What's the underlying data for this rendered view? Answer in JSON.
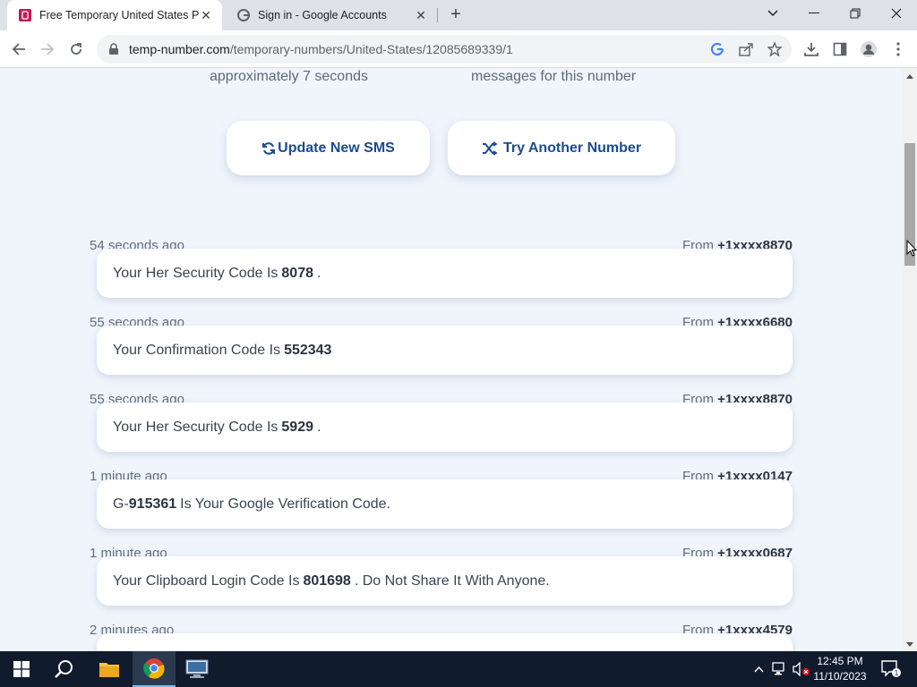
{
  "browser": {
    "tabs": [
      {
        "title": "Free Temporary United States Ph",
        "active": true
      },
      {
        "title": "Sign in - Google Accounts",
        "active": false
      }
    ],
    "url": {
      "host": "temp-number.com",
      "path": "/temporary-numbers/United-States/12085689339/1"
    }
  },
  "page": {
    "info_left": "approximately 7 seconds",
    "info_right": "messages for this number",
    "buttons": {
      "update": "Update New SMS",
      "another": "Try Another Number"
    },
    "from_prefix": "From",
    "messages": [
      {
        "time": "54 seconds ago",
        "from": "+1xxxx8870",
        "pre": "Your Her Security Code Is",
        "code": "8078",
        "post": "."
      },
      {
        "time": "55 seconds ago",
        "from": "+1xxxx6680",
        "pre": "Your Confirmation Code Is",
        "code": "552343",
        "post": ""
      },
      {
        "time": "55 seconds ago",
        "from": "+1xxxx8870",
        "pre": "Your Her Security Code Is",
        "code": "5929",
        "post": "."
      },
      {
        "time": "1 minute ago",
        "from": "+1xxxx0147",
        "pre": "G-",
        "code": "915361",
        "post": "Is Your Google Verification Code."
      },
      {
        "time": "1 minute ago",
        "from": "+1xxxx0687",
        "pre": "Your Clipboard Login Code Is",
        "code": "801698",
        "post": ". Do Not Share It With Anyone."
      },
      {
        "time": "2 minutes ago",
        "from": "+1xxxx4579",
        "pre": "",
        "code": "",
        "post": ""
      }
    ]
  },
  "taskbar": {
    "time": "12:45 PM",
    "date": "11/10/2023",
    "notifications": "1"
  },
  "colors": {
    "accent": "#1b4b8f",
    "page_bg": "#f0f4fb",
    "taskbar_bg": "#101b2d"
  }
}
